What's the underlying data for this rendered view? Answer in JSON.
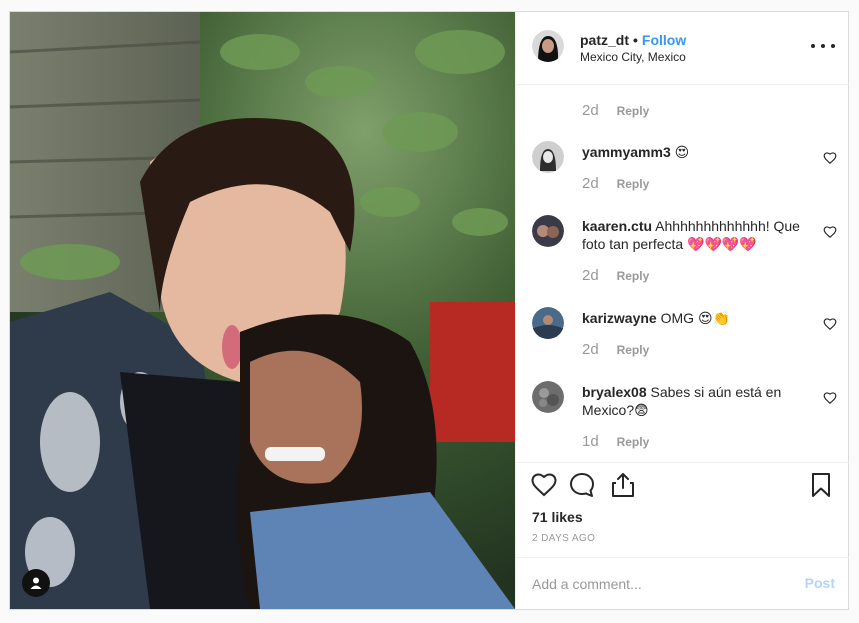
{
  "header": {
    "username": "patz_dt",
    "separator": "•",
    "follow_label": "Follow",
    "location": "Mexico City, Mexico"
  },
  "first_meta": {
    "time": "2d",
    "reply": "Reply"
  },
  "comments": [
    {
      "user": "yammyamm3",
      "text": "😍",
      "time": "2d",
      "reply": "Reply"
    },
    {
      "user": "kaaren.ctu",
      "text": "Ahhhhhhhhhhhhh! Que foto tan perfecta 💖💖💖💖",
      "time": "2d",
      "reply": "Reply"
    },
    {
      "user": "karizwayne",
      "text": "OMG 😍👏",
      "time": "2d",
      "reply": "Reply"
    },
    {
      "user": "bryalex08",
      "text": "Sabes si aún está en Mexico?😨",
      "time": "1d",
      "reply": "Reply"
    }
  ],
  "likes": "71 likes",
  "date": "2 DAYS AGO",
  "add_comment": {
    "placeholder": "Add a comment...",
    "post_label": "Post"
  },
  "icons": {
    "more": "more-options-icon",
    "like": "heart-icon",
    "comment": "comment-icon",
    "share": "share-icon",
    "save": "bookmark-icon",
    "tag": "user-tag-icon"
  },
  "colors": {
    "link": "#3897f0",
    "muted": "#999999",
    "post_disabled": "#b3d4fc"
  }
}
